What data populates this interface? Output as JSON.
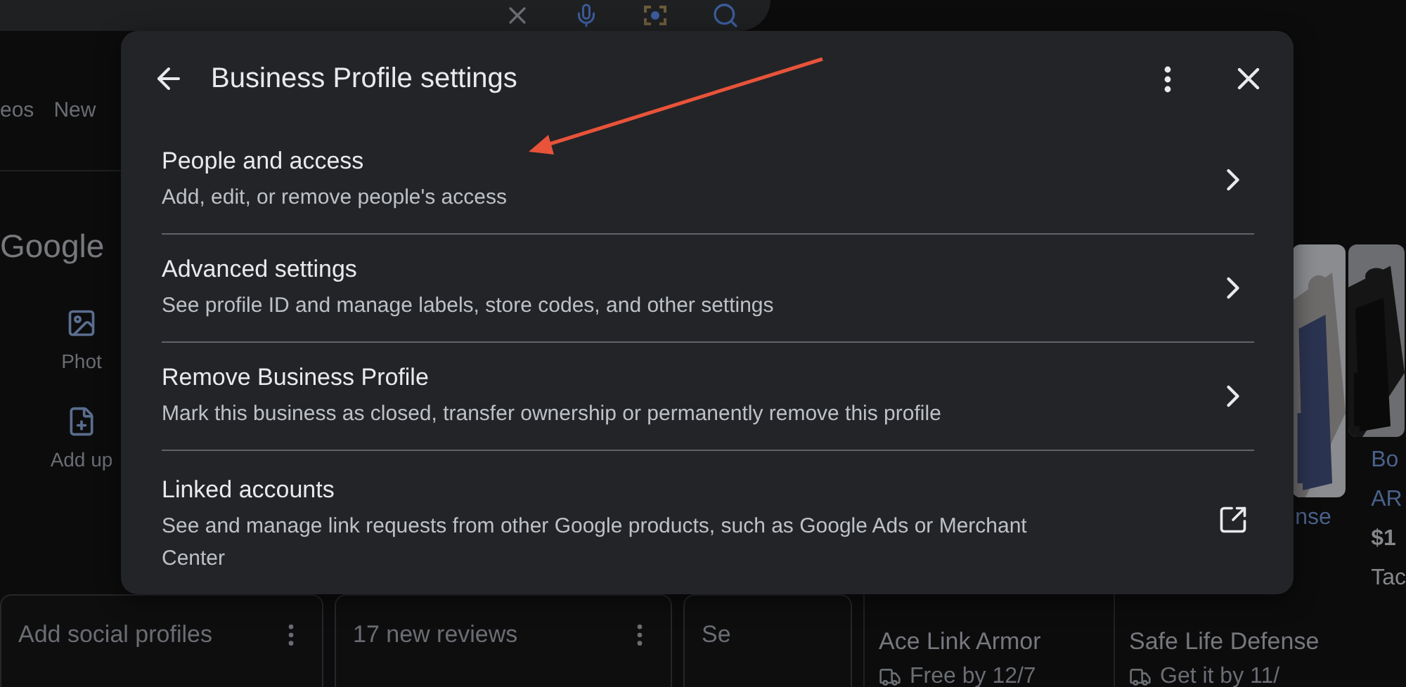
{
  "background": {
    "tabs": [
      "eos",
      "New"
    ],
    "brand": "Google",
    "actions": [
      {
        "label": "Phot"
      },
      {
        "kind": "update",
        "label": "Add up"
      }
    ],
    "cards": [
      {
        "title": "Add social profiles"
      },
      {
        "title": "17 new reviews"
      },
      {
        "title": "Se"
      }
    ],
    "products": [
      {
        "title": "Ace Link Armor",
        "delivery": "Free by 12/7"
      },
      {
        "title": "Safe Life Defense",
        "delivery": "Get it by 11/"
      }
    ],
    "side_text": "nse",
    "edge_product": [
      "Bo",
      "AR",
      "$1",
      "Tac"
    ]
  },
  "dialog": {
    "title": "Business Profile settings",
    "header_buttons": [
      {
        "kind": "back"
      },
      {
        "kind": "more"
      },
      {
        "kind": "close"
      }
    ],
    "items": [
      {
        "kind": "navigate",
        "title": "People and access",
        "subtitle": "Add, edit, or remove people's access"
      },
      {
        "kind": "navigate",
        "title": "Advanced settings",
        "subtitle": "See profile ID and manage labels, store codes, and other settings"
      },
      {
        "kind": "navigate",
        "title": "Remove Business Profile",
        "subtitle": "Mark this business as closed, transfer ownership or permanently remove this profile"
      },
      {
        "kind": "external",
        "title": "Linked accounts",
        "subtitle": "See and manage link requests from other Google products, such as Google Ads or Merchant Center"
      }
    ]
  }
}
